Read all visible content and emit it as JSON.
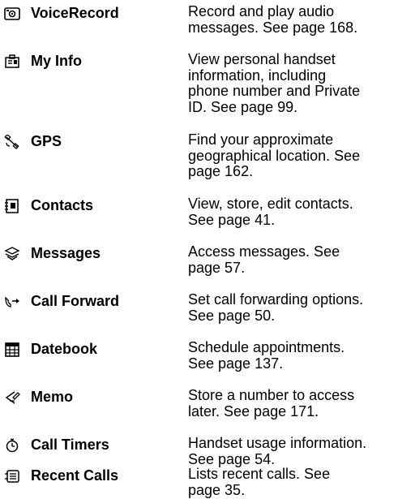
{
  "entries": [
    {
      "icon": "voice-record-icon",
      "name": "VoiceRecord",
      "desc": [
        "Record and play audio",
        "messages. See page 168."
      ]
    },
    {
      "icon": "my-info-icon",
      "name": "My Info",
      "desc": [
        "View personal handset",
        "information, including",
        "phone number and Private",
        "ID. See page 99."
      ]
    },
    {
      "icon": "gps-satellite-icon",
      "name": "GPS",
      "desc": [
        "Find your approximate",
        "geographical location. See",
        "page 162."
      ]
    },
    {
      "icon": "contacts-icon",
      "name": "Contacts",
      "desc": [
        "View, store, edit contacts.",
        "See page 41."
      ]
    },
    {
      "icon": "messages-icon",
      "name": "Messages",
      "desc": [
        "Access messages. See",
        "page 57."
      ]
    },
    {
      "icon": "call-forward-icon",
      "name": "Call Forward",
      "desc": [
        "Set call forwarding options.",
        "See page 50."
      ]
    },
    {
      "icon": "datebook-icon",
      "name": "Datebook",
      "desc": [
        "Schedule appointments.",
        "See page 137."
      ]
    },
    {
      "icon": "memo-icon",
      "name": "Memo",
      "desc": [
        "Store a number to access",
        "later. See page 171."
      ]
    },
    {
      "icon": "call-timers-icon",
      "name": "Call Timers",
      "desc": [
        "Handset usage information.",
        "See page 54."
      ]
    },
    {
      "icon": "recent-calls-icon",
      "name": "Recent Calls",
      "desc": [
        "Lists recent calls. See",
        "page 35."
      ]
    }
  ]
}
